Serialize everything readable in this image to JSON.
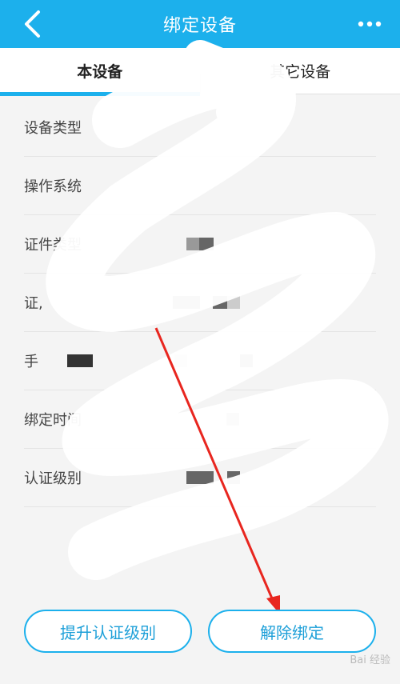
{
  "header": {
    "title": "绑定设备"
  },
  "tabs": [
    {
      "label": "本设备",
      "active": true
    },
    {
      "label": "其它设备",
      "active": false
    }
  ],
  "rows": [
    {
      "label": "设备类型"
    },
    {
      "label": "操作系统"
    },
    {
      "label": "证件类型"
    },
    {
      "label": "证,"
    },
    {
      "label": "手"
    },
    {
      "label": "绑定时间"
    },
    {
      "label": "认证级别"
    }
  ],
  "buttons": {
    "upgrade_label": "提升认证级别",
    "unbind_label": "解除绑定"
  },
  "watermark": "Bai 经验",
  "colors": {
    "primary": "#1cb0ec",
    "annotation_arrow": "#e8261f"
  }
}
